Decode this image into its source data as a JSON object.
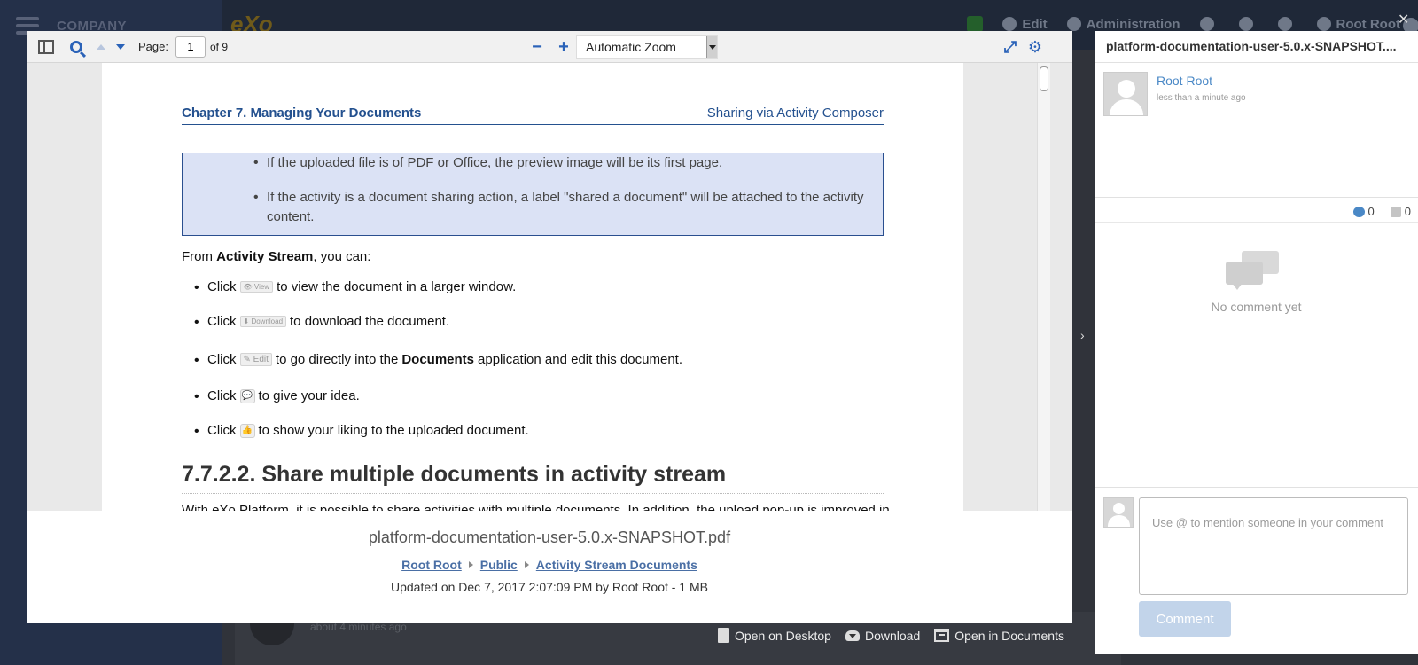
{
  "background": {
    "company": "COMPANY",
    "logo": "eXo",
    "top_items": [
      "Edit",
      "Administration",
      "Root Root"
    ],
    "activity_time": "about 4 minutes ago"
  },
  "toolbar": {
    "page_label": "Page:",
    "page_value": "1",
    "page_of": "of 9",
    "zoom_minus": "−",
    "zoom_plus": "+",
    "zoom_value": "Automatic Zoom"
  },
  "pdf": {
    "chapter_left": "Chapter 7. Managing Your Documents",
    "chapter_right": "Sharing via Activity Composer",
    "note_items": [
      "If the uploaded file is of PDF or Office, the preview image will be its first page.",
      "If the activity is a document sharing action, a label \"shared a document\" will be attached to the activity content."
    ],
    "from_prefix": "From ",
    "from_bold": "Activity Stream",
    "from_suffix": ", you can:",
    "bullets": [
      {
        "pre": "Click",
        "btn": "View",
        "post": "to view the document in a larger window."
      },
      {
        "pre": "Click",
        "btn": "Download",
        "post": "to download the document."
      },
      {
        "pre": "Click",
        "btn": "Edit",
        "post_a": "to go directly into the ",
        "bold": "Documents",
        "post_b": " application and edit this document."
      },
      {
        "pre": "Click",
        "post": "to give your idea."
      },
      {
        "pre": "Click",
        "post": "to show your liking to the uploaded document."
      }
    ],
    "section_title": "7.7.2.2. Share multiple documents in activity stream",
    "cut_text": "With eXo Platform, it is possible to share activities with multiple documents. In addition, the upload pop-up is improved in"
  },
  "doc_info": {
    "title": "platform-documentation-user-5.0.x-SNAPSHOT.pdf",
    "breadcrumb": [
      "Root Root",
      "Public",
      "Activity Stream Documents"
    ],
    "updated": "Updated on Dec 7, 2017 2:07:09 PM by Root Root - 1 MB"
  },
  "actions": {
    "open_desktop": "Open on Desktop",
    "download": "Download",
    "open_documents": "Open in Documents"
  },
  "comments_panel": {
    "title": "platform-documentation-user-5.0.x-SNAPSHOT....",
    "user": "Root Root",
    "time": "less than a minute ago",
    "comment_count": "0",
    "like_count": "0",
    "empty_text": "No comment yet",
    "input_placeholder": "Use @ to mention someone in your comment",
    "submit_label": "Comment"
  }
}
